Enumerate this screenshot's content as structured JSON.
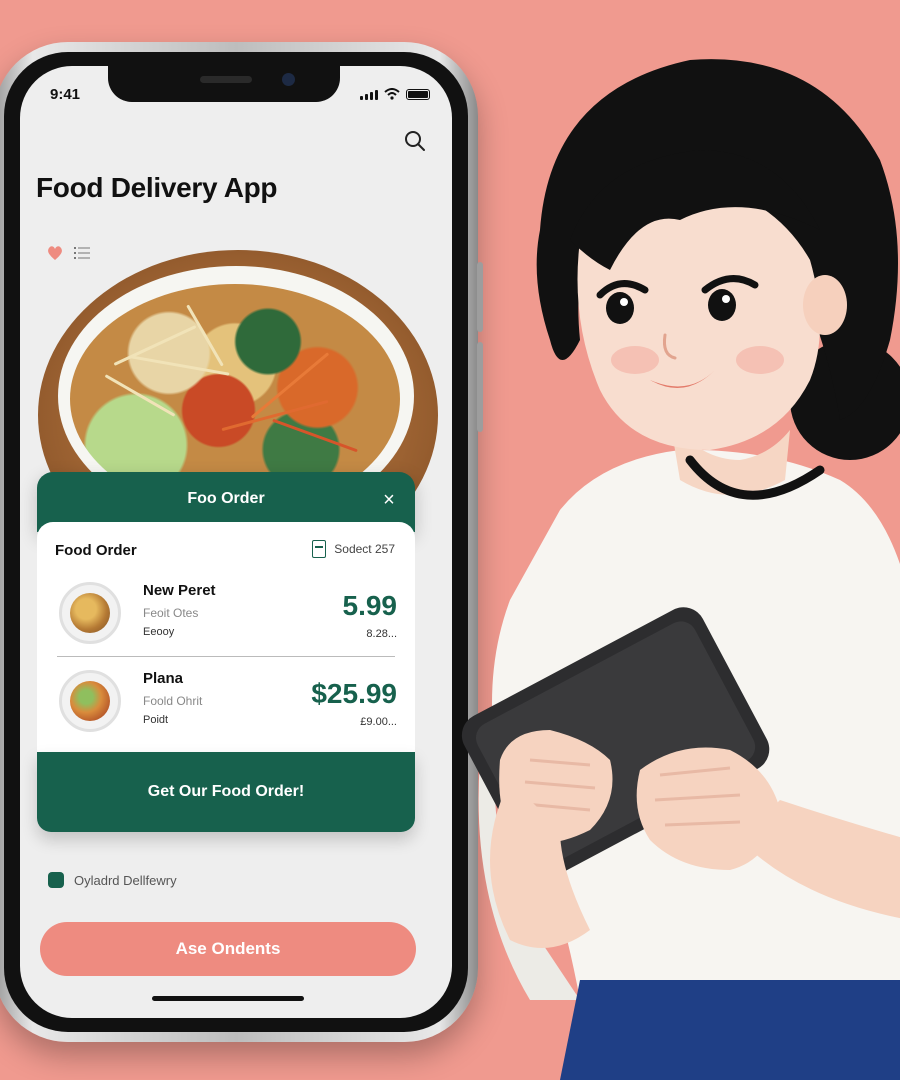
{
  "status_bar": {
    "time": "9:41"
  },
  "app": {
    "title": "Food Delivery App"
  },
  "order_header": {
    "title": "Foo Order",
    "close_label": "×"
  },
  "order_card": {
    "title": "Food Order",
    "select_label": "Sodect 257",
    "items": [
      {
        "name": "New Peret",
        "sub": "Feoit Otes",
        "sub2": "Eeooy",
        "price": "5.99",
        "price_sub": "8.28..."
      },
      {
        "name": "Plana",
        "sub": "Foold Ohrit",
        "sub2": "Poidt",
        "price": "$25.99",
        "price_sub": "£9.00..."
      }
    ]
  },
  "cta": {
    "label": "Get Our Food Order!"
  },
  "delivery": {
    "label": "Oyladrd Dellfewry"
  },
  "orders_button": {
    "label": "Ase Ondents"
  },
  "colors": {
    "brand_green": "#17614d",
    "accent_pink": "#ee8b80",
    "background": "#f09a8f"
  },
  "icons": [
    "search-icon",
    "heart-icon",
    "list-icon",
    "close-icon",
    "cart-icon",
    "pin-icon",
    "wifi-icon",
    "battery-icon",
    "signal-icon"
  ]
}
